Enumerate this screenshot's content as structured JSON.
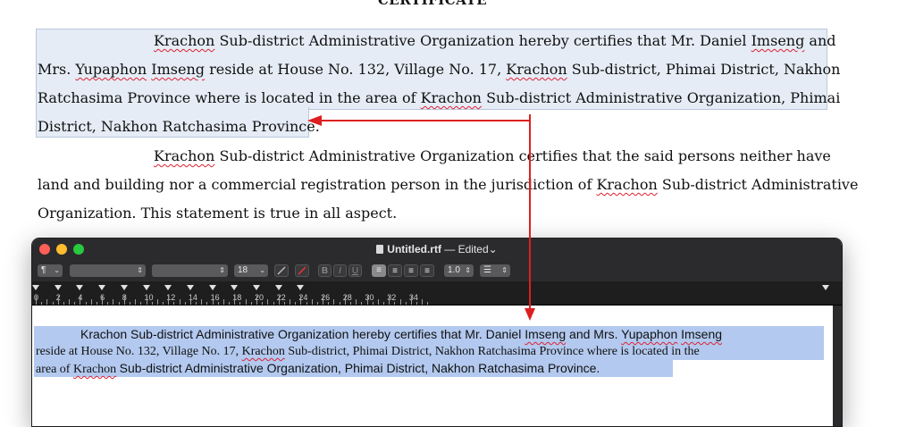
{
  "document": {
    "title": "CERTIFICATE",
    "para1": {
      "l1a": "Krachon",
      "l1b": "Sub-district Administrative Organization hereby certifies that Mr. Daniel",
      "l1c": "Imseng",
      "l1d": "and",
      "l2a": "Mrs.",
      "l2b": "Yupaphon",
      "l2c": "Imseng",
      "l2d": "reside at House No. 132, Village No. 17,",
      "l2e": "Krachon",
      "l2f": "Sub-district, Phimai District, Nakhon",
      "l3a": "Ratchasima Province where is located in the area of",
      "l3b": "Krachon",
      "l3c": "Sub-district Administrative Organization, Phimai",
      "l4": "District, Nakhon Ratchasima Province."
    },
    "para2": {
      "l1a": "Krachon",
      "l1b": "Sub-district Administrative Organization certifies that the said persons neither have",
      "l2a": "land and building nor a commercial registration person in the jurisdiction of",
      "l2b": "Krachon",
      "l2c": "Sub-district Administrative",
      "l3": "Organization. This statement is true in all aspect."
    }
  },
  "window": {
    "filename": "Untitled.rtf",
    "separator": "—",
    "status": "Edited",
    "toolbar": {
      "paragraph_style": "¶",
      "font_family": "",
      "font_typeface": "",
      "font_size": "18",
      "bold": "B",
      "italic": "I",
      "underline": "U",
      "line_spacing": "1.0",
      "list": "☰"
    },
    "ruler_numbers": [
      "0",
      "2",
      "4",
      "6",
      "8",
      "10",
      "12",
      "14",
      "16",
      "18",
      "20",
      "22",
      "24",
      "26",
      "28",
      "30",
      "32",
      "34"
    ],
    "pasted": {
      "l1a": "Krachon Sub-district Administrative Organization hereby certifies that Mr. Daniel",
      "l1b": "Imseng",
      "l1c": "and Mrs.",
      "l1d": "Yupaphon",
      "l1e": "Imseng",
      "l2a": "reside at House No. 132, Village No. 17,",
      "l2b": "Krachon",
      "l2c": "Sub-district, Phimai District, Nakhon Ratchasima Province where is located in the",
      "l3a": "area of",
      "l3b": "Krachon",
      "l3c": "Sub-district Administrative Organization, Phimai District, Nakhon Ratchasima Province."
    }
  },
  "colors": {
    "annotation_arrow": "#dd1f1f",
    "selection_highlight": "#b3c9ef",
    "spell_underline": "#dd2233"
  }
}
